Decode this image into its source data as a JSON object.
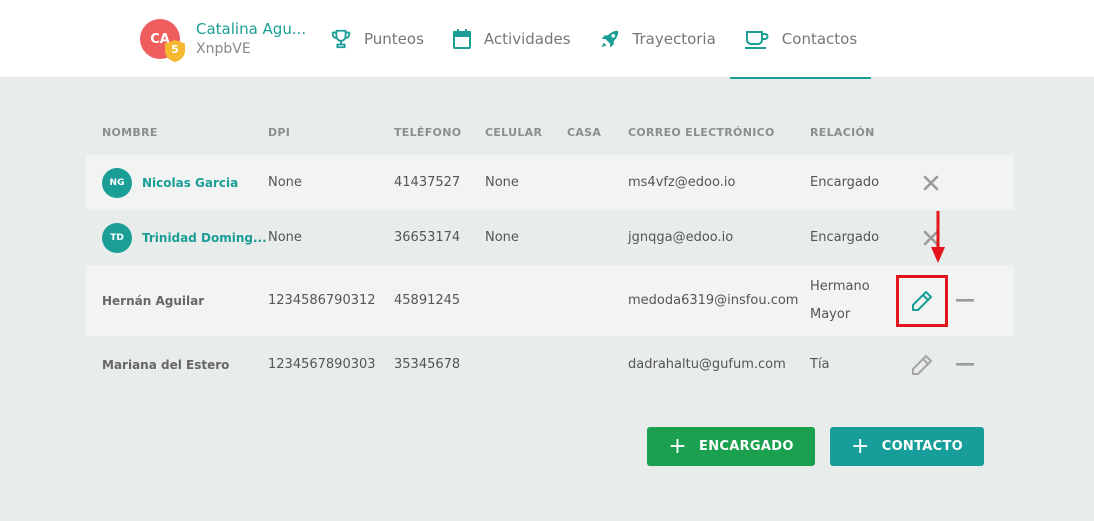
{
  "profile": {
    "initials": "CA",
    "level": "5",
    "name": "Catalina Agu...",
    "code": "XnpbVE"
  },
  "nav": {
    "tabs": [
      {
        "label": "Punteos",
        "icon": "trophy-icon"
      },
      {
        "label": "Actividades",
        "icon": "calendar-icon"
      },
      {
        "label": "Trayectoria",
        "icon": "rocket-icon"
      },
      {
        "label": "Contactos",
        "icon": "coffee-cup-icon",
        "active": true
      }
    ]
  },
  "table": {
    "headers": {
      "name": "NOMBRE",
      "dpi": "DPI",
      "tel": "TELÉFONO",
      "cel": "CELULAR",
      "casa": "CASA",
      "mail": "CORREO ELECTRÓNICO",
      "rel": "RELACIÓN"
    },
    "rows": [
      {
        "initials": "NG",
        "name": "Nicolas Garcia",
        "dpi": "None",
        "tel": "41437527",
        "cel": "None",
        "casa": "",
        "mail": "ms4vfz@edoo.io",
        "rel": "Encargado",
        "action": "remove-icon"
      },
      {
        "initials": "TD",
        "name": "Trinidad Doming...",
        "dpi": "None",
        "tel": "36653174",
        "cel": "None",
        "casa": "",
        "mail": "jgnqga@edoo.io",
        "rel": "Encargado",
        "action": "remove-icon"
      },
      {
        "name": "Hernán Aguilar",
        "dpi": "1234586790312",
        "tel": "45891245",
        "cel": "",
        "casa": "",
        "mail": "medoda6319@insfou.com",
        "rel_line1": "Hermano",
        "rel_line2": "Mayor",
        "action": "pencil-icon",
        "highlighted": true
      },
      {
        "name": "Mariana del Estero",
        "dpi": "1234567890303",
        "tel": "35345678",
        "cel": "",
        "casa": "",
        "mail": "dadrahaltu@gufum.com",
        "rel": "Tía",
        "action": "pencil-icon"
      }
    ]
  },
  "buttons": {
    "plus": "+",
    "encargado": "ENCARGADO",
    "contacto": "CONTACTO"
  },
  "colors": {
    "teal": "#1a9e96",
    "green": "#1aa04f",
    "avatar_red": "#ef5d5d",
    "badge_yellow": "#f5b82e",
    "highlight_red": "#e3141b"
  }
}
